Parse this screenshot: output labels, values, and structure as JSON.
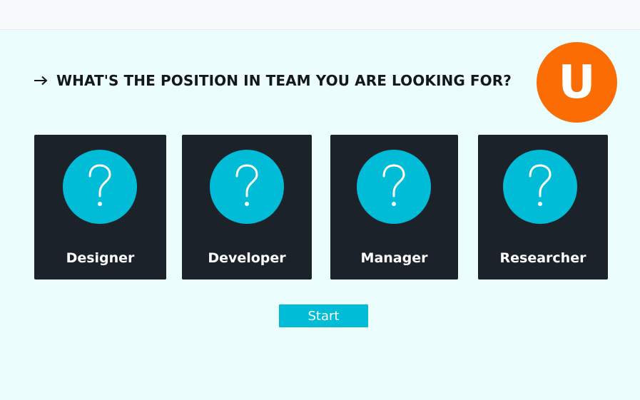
{
  "header": {
    "question": "WHAT'S THE POSITION IN TEAM YOU ARE LOOKING FOR?",
    "arrow_icon": "arrow-right-icon"
  },
  "avatar": {
    "letter": "U",
    "color": "#fb6d02"
  },
  "roles": [
    {
      "label": "Designer",
      "icon": "question-mark-icon"
    },
    {
      "label": "Developer",
      "icon": "question-mark-icon"
    },
    {
      "label": "Manager",
      "icon": "question-mark-icon"
    },
    {
      "label": "Researcher",
      "icon": "question-mark-icon"
    }
  ],
  "start_button": {
    "label": "Start"
  },
  "colors": {
    "background": "#ebfdfd",
    "card": "#1c2229",
    "accent": "#00bcd6",
    "text_dark": "#14181d"
  }
}
